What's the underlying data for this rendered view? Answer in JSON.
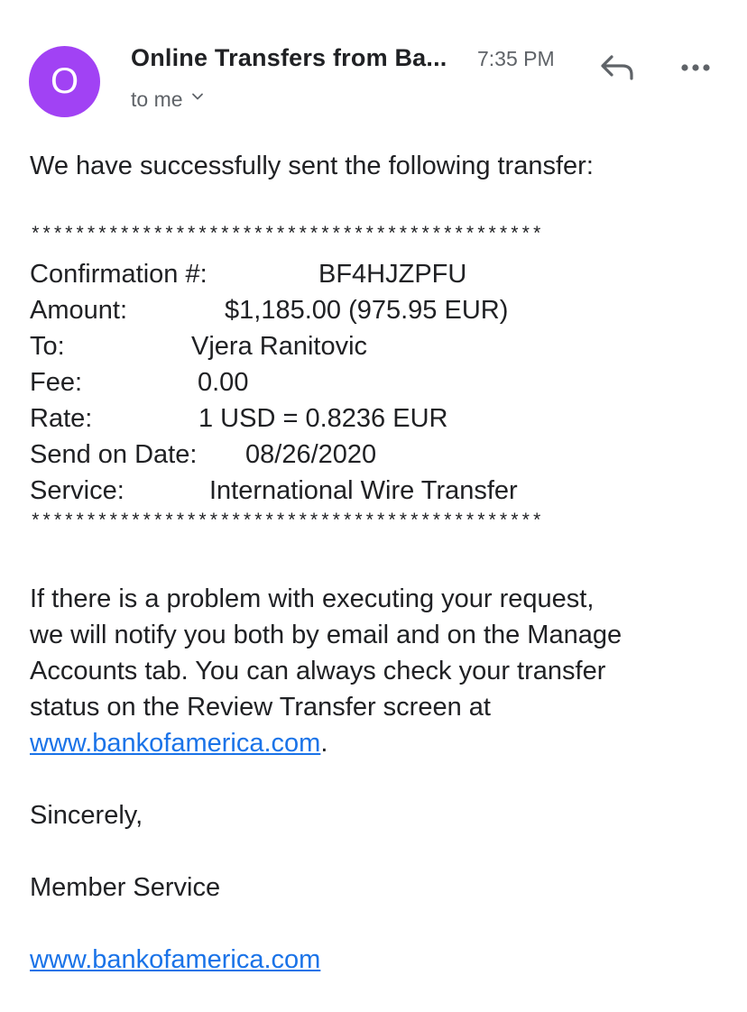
{
  "header": {
    "avatar_letter": "O",
    "sender": "Online Transfers from Ba...",
    "time": "7:35 PM",
    "recipient": "to me",
    "avatar_color": "#a142f4",
    "icons": [
      "reply-icon",
      "more-options-icon",
      "chevron-down-icon"
    ]
  },
  "body": {
    "intro": "We have successfully sent the following transfer:",
    "separator": "**********************************************",
    "details": [
      {
        "label": "Confirmation #:",
        "value": "BF4HJZPFU"
      },
      {
        "label": "Amount:",
        "value": "$1,185.00 (975.95 EUR)"
      },
      {
        "label": "To:",
        "value": "Vjera Ranitovic"
      },
      {
        "label": "Fee:",
        "value": "0.00"
      },
      {
        "label": "Rate:",
        "value": "1 USD = 0.8236 EUR"
      },
      {
        "label": "Send on Date:",
        "value": "08/26/2020"
      },
      {
        "label": "Service:",
        "value": "International Wire Transfer"
      }
    ],
    "notice_lines": [
      "If there is a problem with executing your request,",
      "we will notify you both by email and on the Manage",
      "Accounts tab. You can always check your transfer",
      "status on the Review Transfer screen at"
    ],
    "notice_link": "www.bankofamerica.com",
    "notice_link_suffix": ".",
    "closing": "Sincerely,",
    "signature": "Member Service",
    "footer_link": "www.bankofamerica.com",
    "link_color": "#1a73e8"
  }
}
